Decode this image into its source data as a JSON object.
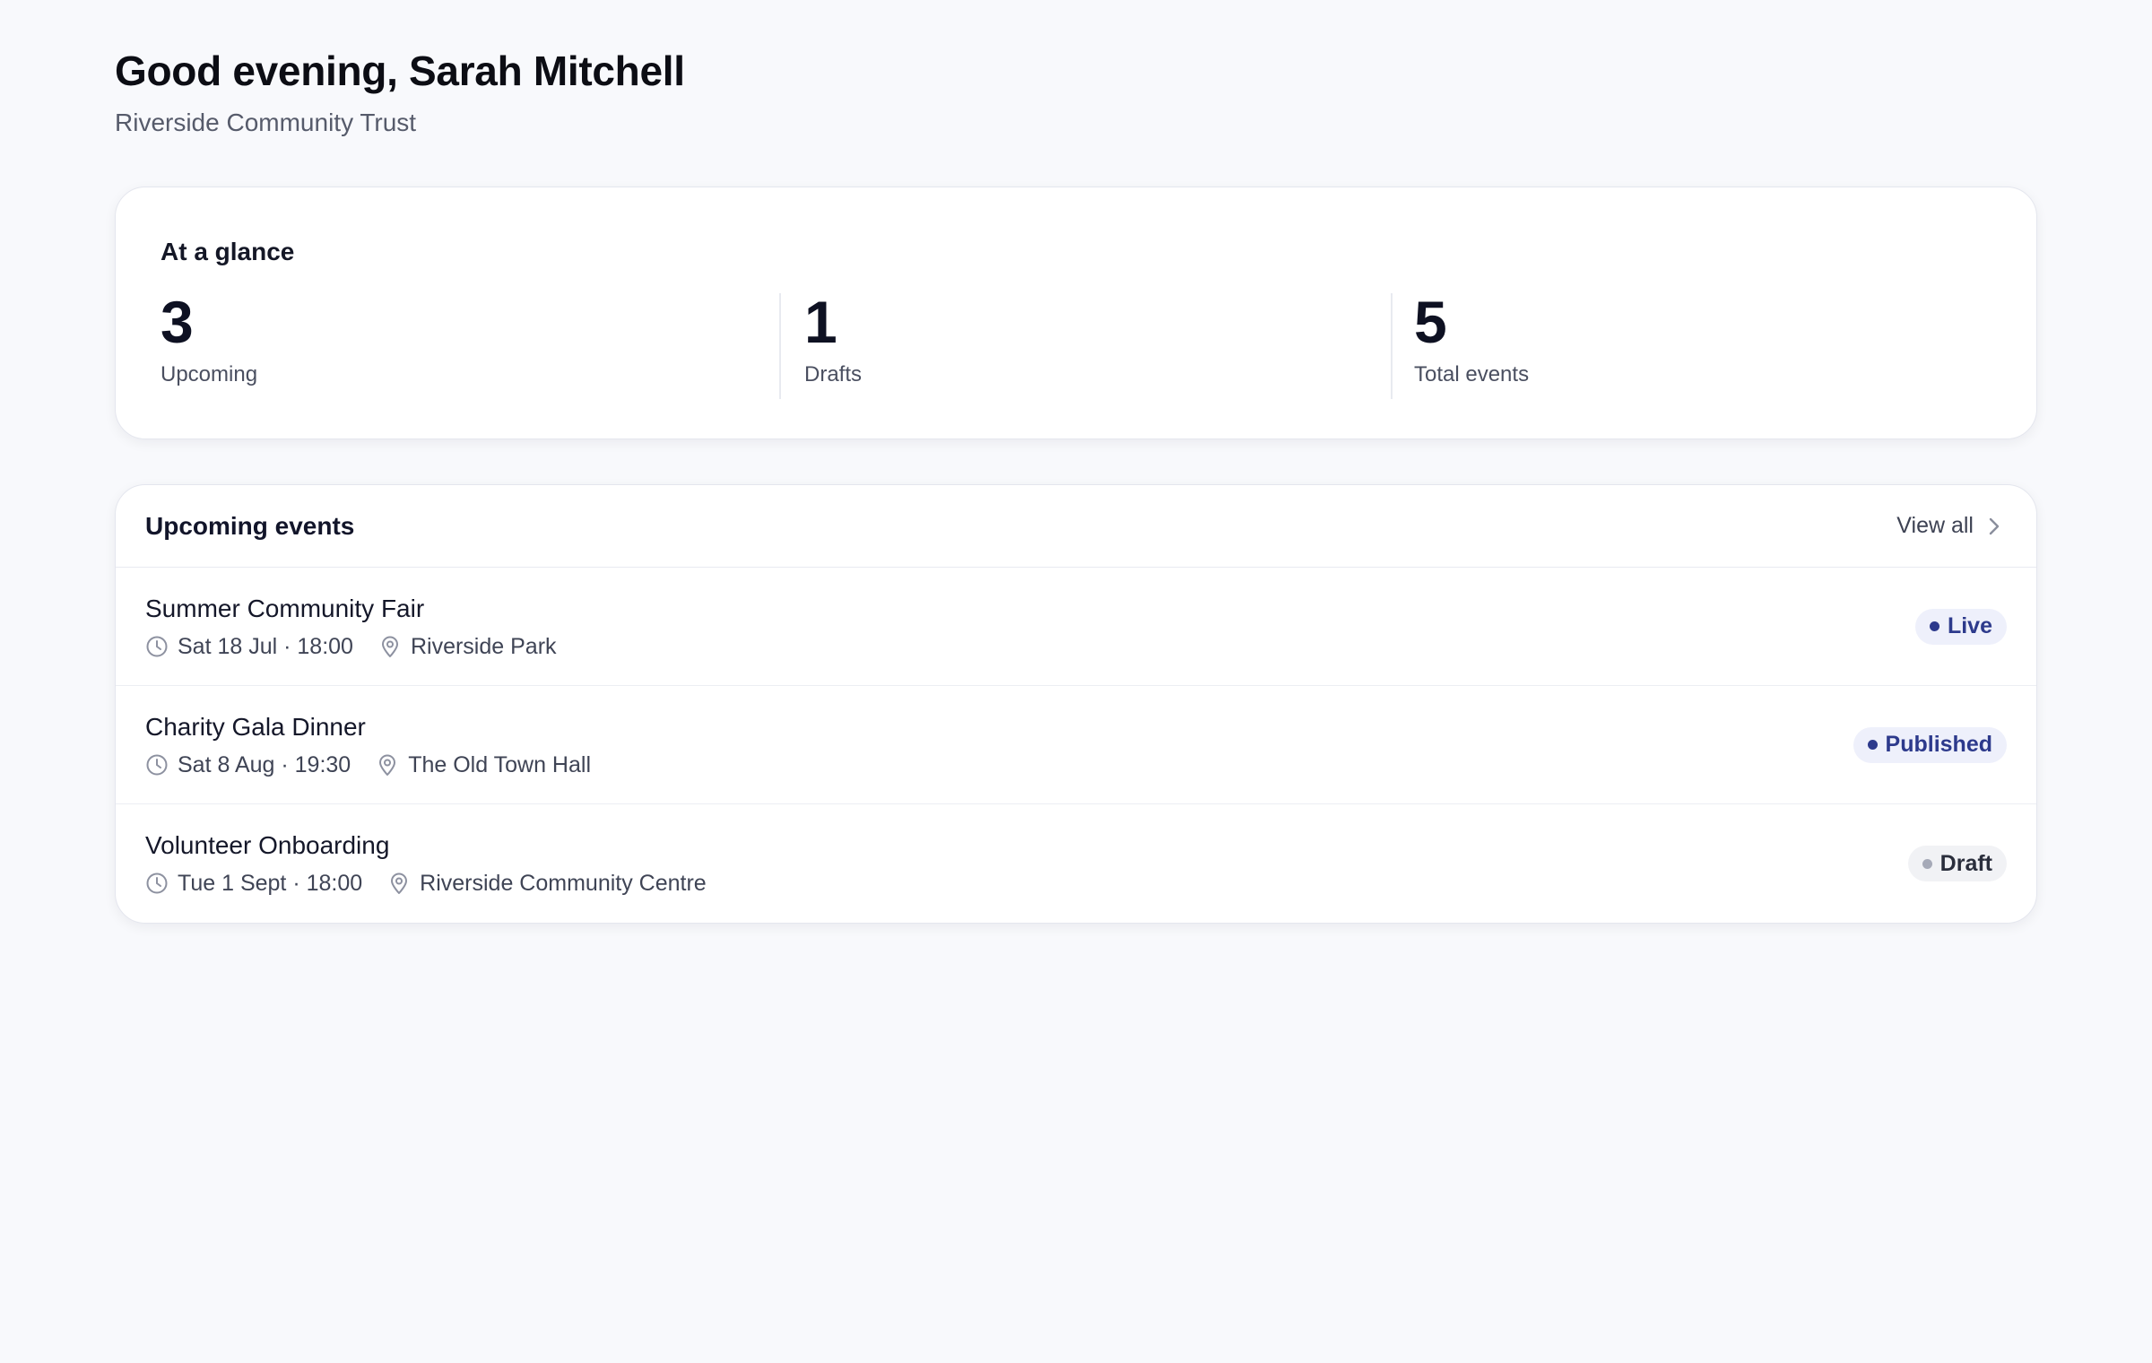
{
  "header": {
    "greeting": "Good evening, Sarah Mitchell",
    "organisation": "Riverside Community Trust"
  },
  "glance": {
    "title": "At a glance",
    "stats": [
      {
        "value": "3",
        "label": "Upcoming"
      },
      {
        "value": "1",
        "label": "Drafts"
      },
      {
        "value": "5",
        "label": "Total events"
      }
    ]
  },
  "events": {
    "title": "Upcoming events",
    "view_all_label": "View all",
    "items": [
      {
        "name": "Summer Community Fair",
        "datetime": "Sat 18 Jul · 18:00",
        "location": "Riverside Park",
        "status": "Live"
      },
      {
        "name": "Charity Gala Dinner",
        "datetime": "Sat 8 Aug · 19:30",
        "location": "The Old Town Hall",
        "status": "Published"
      },
      {
        "name": "Volunteer Onboarding",
        "datetime": "Tue 1 Sept · 18:00",
        "location": "Riverside Community Centre",
        "status": "Draft"
      }
    ]
  },
  "colors": {
    "background": "#f8f9fc",
    "accent": "#2d3a8c",
    "badge_bg": "#eef0fb",
    "draft_dot": "#a6aab8"
  },
  "icons": {
    "time": "clock-icon",
    "location": "map-pin-icon",
    "view_all": "chevron-right-icon"
  }
}
